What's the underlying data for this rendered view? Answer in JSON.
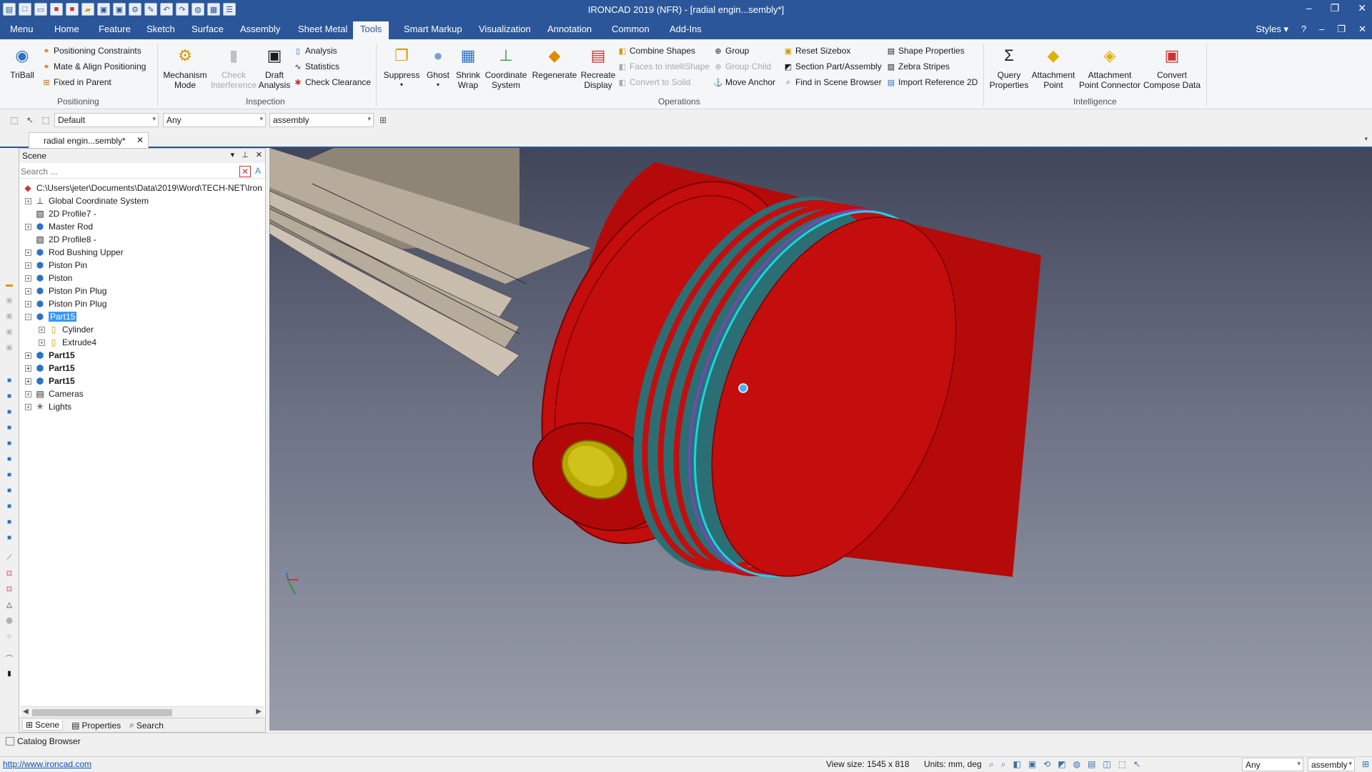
{
  "app": {
    "title": "IRONCAD 2019 (NFR) - [radial engin...sembly*]",
    "qat_icons": [
      "app-menu-icon",
      "new-icon",
      "new-drawing-icon",
      "pdf-icon",
      "pdf-export-icon",
      "open-icon",
      "save-icon",
      "save-all-icon",
      "settings-icon",
      "tools-icon",
      "undo-icon",
      "redo-icon",
      "globe-icon",
      "tile-icon",
      "layout-icon"
    ]
  },
  "ribbon_tabs": [
    "Menu",
    "Home",
    "Feature",
    "Sketch",
    "Surface",
    "Assembly",
    "Sheet Metal",
    "Tools",
    "Smart Markup",
    "Visualization",
    "Annotation",
    "Common",
    "Add-Ins"
  ],
  "active_tab": "Tools",
  "styles_label": "Styles",
  "ribbon": {
    "positioning": {
      "label": "Positioning",
      "triball": "TriBall",
      "items": [
        "Positioning Constraints",
        "Mate & Align Positioning",
        "Fixed in Parent"
      ]
    },
    "inspection": {
      "label": "Inspection",
      "mechanism_l1": "Mechanism",
      "mechanism_l2": "Mode",
      "check_l1": "Check",
      "check_l2": "Interference",
      "draft_l1": "Draft",
      "draft_l2": "Analysis",
      "items": [
        "Analysis",
        "Statistics",
        "Check Clearance"
      ]
    },
    "operations": {
      "label": "Operations",
      "suppress": "Suppress",
      "ghost": "Ghost",
      "shrink_l1": "Shrink",
      "shrink_l2": "Wrap",
      "coord_l1": "Coordinate",
      "coord_l2": "System",
      "regenerate": "Regenerate",
      "recreate_l1": "Recreate",
      "recreate_l2": "Display",
      "col1": [
        "Combine Shapes",
        "Faces to IntelliShape",
        "Convert to Solid"
      ],
      "col2": [
        "Group",
        "Group Child",
        "Move Anchor"
      ],
      "col3": [
        "Reset Sizebox",
        "Section Part/Assembly",
        "Find in Scene Browser"
      ],
      "col4": [
        "Shape Properties",
        "Zebra Stripes",
        "Import Reference 2D"
      ]
    },
    "intelligence": {
      "label": "Intelligence",
      "query_l1": "Query",
      "query_l2": "Properties",
      "attach_l1": "Attachment",
      "attach_l2": "Point",
      "apc_l1": "Attachment",
      "apc_l2": "Point Connector",
      "convert_l1": "Convert",
      "convert_l2": "Compose Data"
    }
  },
  "filter_bar": {
    "style_combo": "Default",
    "filter_combo": "Any",
    "level_combo": "assembly"
  },
  "document_tab": "radial engin...sembly*",
  "scene": {
    "title": "Scene",
    "search_placeholder": "Search ...",
    "root_path": "C:\\Users\\jeter\\Documents\\Data\\2019\\Word\\TECH-NET\\Iron",
    "nodes": [
      {
        "label": "Global Coordinate System"
      },
      {
        "label": "2D Profile7 -"
      },
      {
        "label": "Master Rod"
      },
      {
        "label": "2D Profile8 -"
      },
      {
        "label": "Rod Bushing Upper"
      },
      {
        "label": "Piston Pin"
      },
      {
        "label": "Piston"
      },
      {
        "label": "Piston Pin Plug"
      },
      {
        "label": "Piston Pin Plug"
      },
      {
        "label": "Part15"
      },
      {
        "label": "Cylinder"
      },
      {
        "label": "Extrude4"
      },
      {
        "label": "Part15"
      },
      {
        "label": "Part15"
      },
      {
        "label": "Part15"
      },
      {
        "label": "Cameras"
      },
      {
        "label": "Lights"
      }
    ],
    "tabs": [
      "Scene",
      "Properties",
      "Search"
    ]
  },
  "catalog_browser": "Catalog Browser",
  "status": {
    "link": "http://www.ironcad.com",
    "view_size": "View size: 1545 x  818",
    "units": "Units: mm, deg",
    "filter_combo": "Any",
    "level_combo": "assembly"
  },
  "colors": {
    "accent": "#2b579a",
    "piston": "#c40d0d",
    "ring_groove": "#2b6f74",
    "ring_highlight": "#19d6e0",
    "pin_plug": "#b7a800",
    "rod": "#a89a8a",
    "selection": "#3399ff"
  }
}
